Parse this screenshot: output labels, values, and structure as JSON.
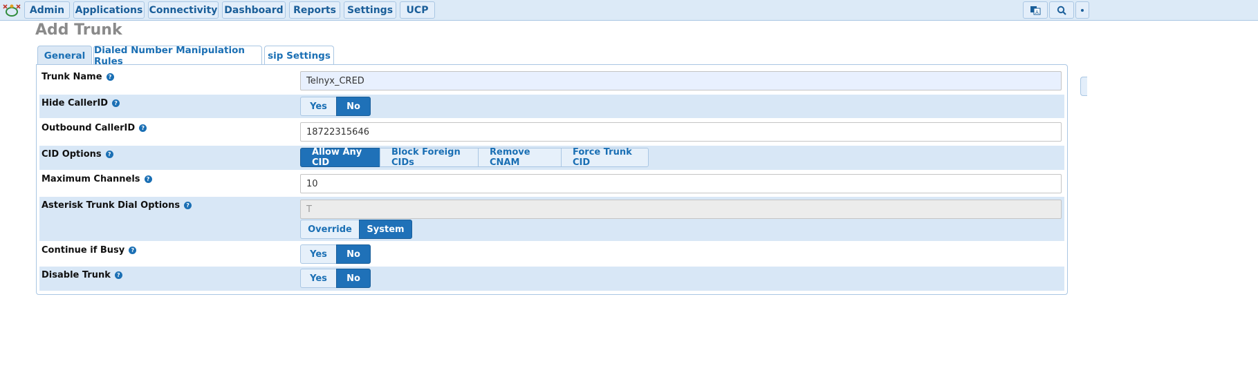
{
  "nav": {
    "items": [
      {
        "label": "Admin"
      },
      {
        "label": "Applications"
      },
      {
        "label": "Connectivity"
      },
      {
        "label": "Dashboard"
      },
      {
        "label": "Reports"
      },
      {
        "label": "Settings"
      },
      {
        "label": "UCP"
      }
    ],
    "icons": [
      "translate-icon",
      "search-icon",
      "more-icon"
    ]
  },
  "page": {
    "title": "Add Trunk"
  },
  "tabs": [
    {
      "label": "General",
      "active": true
    },
    {
      "label": "Dialed Number Manipulation Rules",
      "active": false
    },
    {
      "label": "sip Settings",
      "active": false
    }
  ],
  "form": {
    "trunk_name": {
      "label": "Trunk Name",
      "value": "Telnyx_CRED"
    },
    "hide_callerid": {
      "label": "Hide CallerID",
      "options": [
        "Yes",
        "No"
      ],
      "selected": "No"
    },
    "outbound_callerid": {
      "label": "Outbound CallerID",
      "value": "18722315646"
    },
    "cid_options": {
      "label": "CID Options",
      "options": [
        "Allow Any CID",
        "Block Foreign CIDs",
        "Remove CNAM",
        "Force Trunk CID"
      ],
      "selected": "Allow Any CID"
    },
    "max_channels": {
      "label": "Maximum Channels",
      "value": "10"
    },
    "dial_options": {
      "label": "Asterisk Trunk Dial Options",
      "value": "T",
      "options": [
        "Override",
        "System"
      ],
      "selected": "System"
    },
    "continue_if_busy": {
      "label": "Continue if Busy",
      "options": [
        "Yes",
        "No"
      ],
      "selected": "No"
    },
    "disable_trunk": {
      "label": "Disable Trunk",
      "options": [
        "Yes",
        "No"
      ],
      "selected": "No"
    }
  },
  "colors": {
    "accent": "#1f71b8",
    "row_alt": "#d8e7f6",
    "nav_bg": "#dceaf7"
  }
}
